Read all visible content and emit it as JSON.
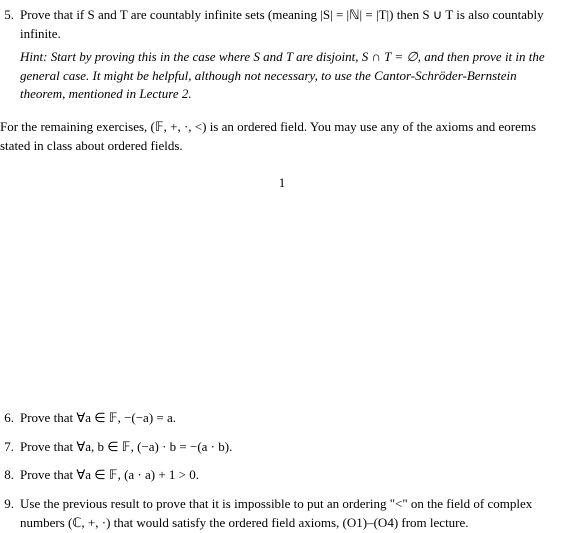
{
  "problems": {
    "p5": {
      "num": "5.",
      "text": "Prove that if S and T are countably infinite sets (meaning |S| = |ℕ| = |T|) then S ∪ T is also countably infinite.",
      "hint": "Hint: Start by proving this in the case where S and T are disjoint, S ∩ T = ∅, and then prove it in the general case. It might be helpful, although not necessary, to use the Cantor-Schröder-Bernstein theorem, mentioned in Lecture 2."
    },
    "section_note": "For the remaining exercises, (𝔽, +, ·, <) is an ordered field. You may use any of the axioms and eorems stated in class about ordered fields.",
    "page_number": "1",
    "p6": {
      "num": "6.",
      "text": "Prove that ∀a ∈ 𝔽, −(−a) = a."
    },
    "p7": {
      "num": "7.",
      "text": "Prove that ∀a, b ∈ 𝔽, (−a) · b = −(a · b)."
    },
    "p8": {
      "num": "8.",
      "text": "Prove that ∀a ∈ 𝔽, (a · a) + 1 > 0."
    },
    "p9": {
      "num": "9.",
      "text": "Use the previous result to prove that it is impossible to put an ordering \"<\" on the field of complex numbers (ℂ, +, ·) that would satisfy the ordered field axioms, (O1)–(O4) from lecture."
    }
  }
}
